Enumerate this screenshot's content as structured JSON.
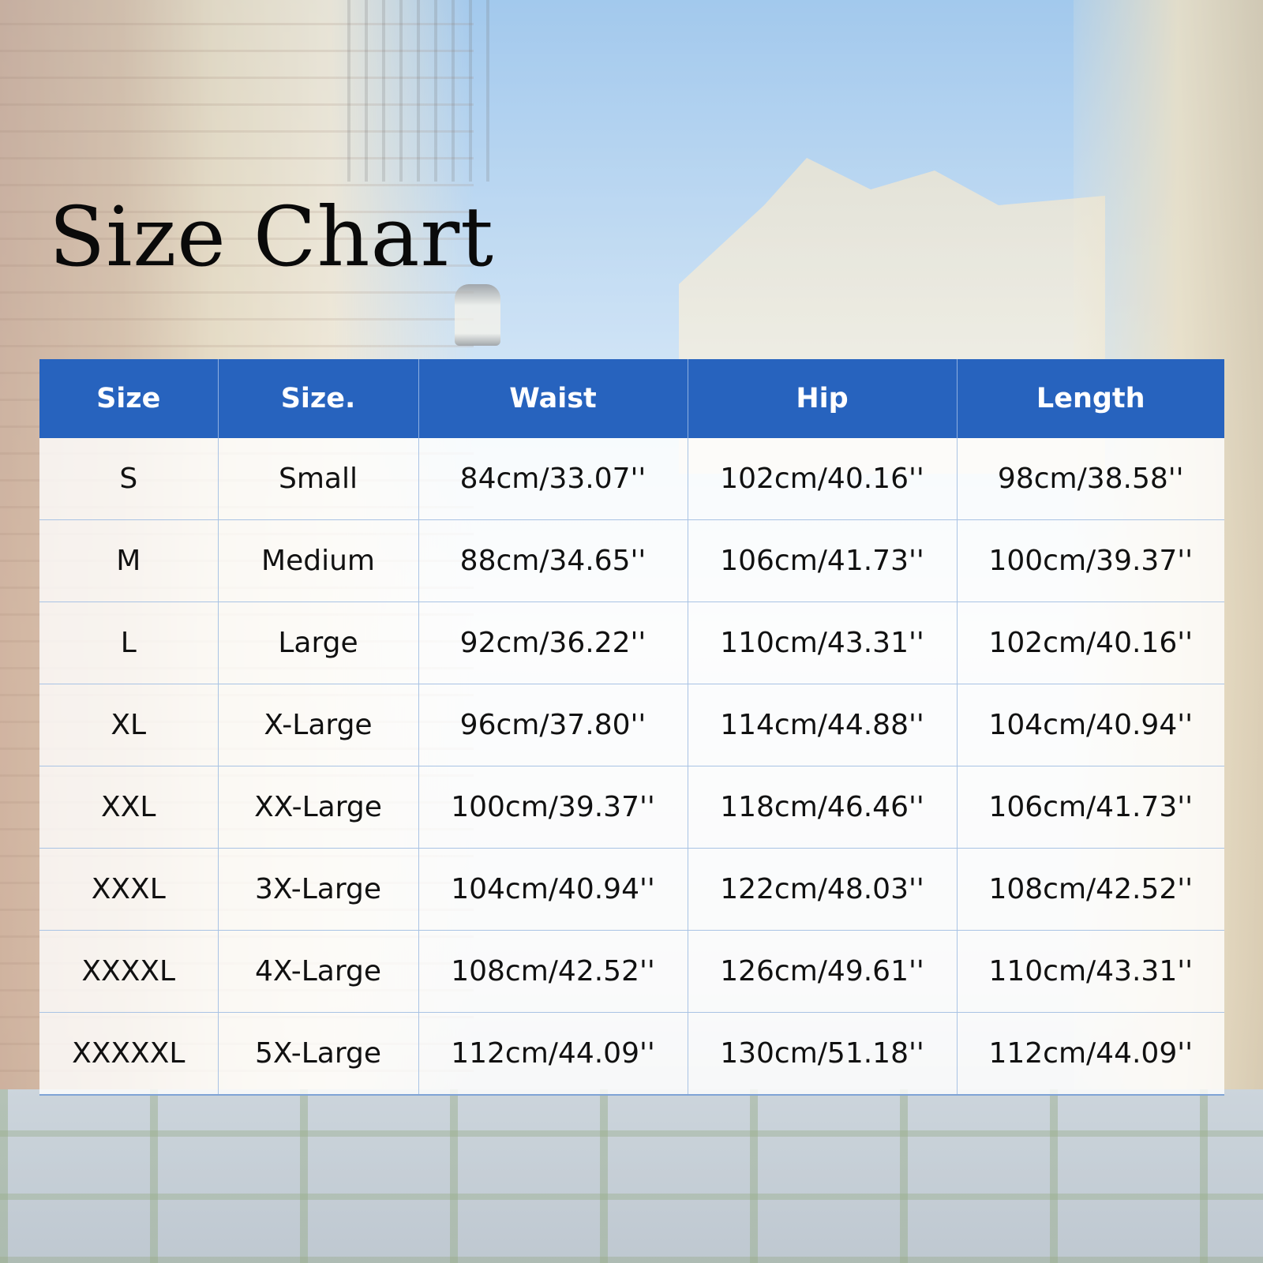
{
  "title": "Size Chart",
  "colors": {
    "header_bg": "#2763be",
    "header_text": "#ffffff",
    "cell_bg": "#ffffff",
    "grid_line": "#a9c3e4"
  },
  "table": {
    "headers": [
      "Size",
      "Size.",
      "Waist",
      "Hip",
      "Length"
    ],
    "rows": [
      [
        "S",
        "Small",
        "84cm/33.07''",
        "102cm/40.16''",
        "98cm/38.58''"
      ],
      [
        "M",
        "Medium",
        "88cm/34.65''",
        "106cm/41.73''",
        "100cm/39.37''"
      ],
      [
        "L",
        "Large",
        "92cm/36.22''",
        "110cm/43.31''",
        "102cm/40.16''"
      ],
      [
        "XL",
        "X-Large",
        "96cm/37.80''",
        "114cm/44.88''",
        "104cm/40.94''"
      ],
      [
        "XXL",
        "XX-Large",
        "100cm/39.37''",
        "118cm/46.46''",
        "106cm/41.73''"
      ],
      [
        "XXXL",
        "3X-Large",
        "104cm/40.94''",
        "122cm/48.03''",
        "108cm/42.52''"
      ],
      [
        "XXXXL",
        "4X-Large",
        "108cm/42.52''",
        "126cm/49.61''",
        "110cm/43.31''"
      ],
      [
        "XXXXXL",
        "5X-Large",
        "112cm/44.09''",
        "130cm/51.18''",
        "112cm/44.09''"
      ]
    ]
  }
}
